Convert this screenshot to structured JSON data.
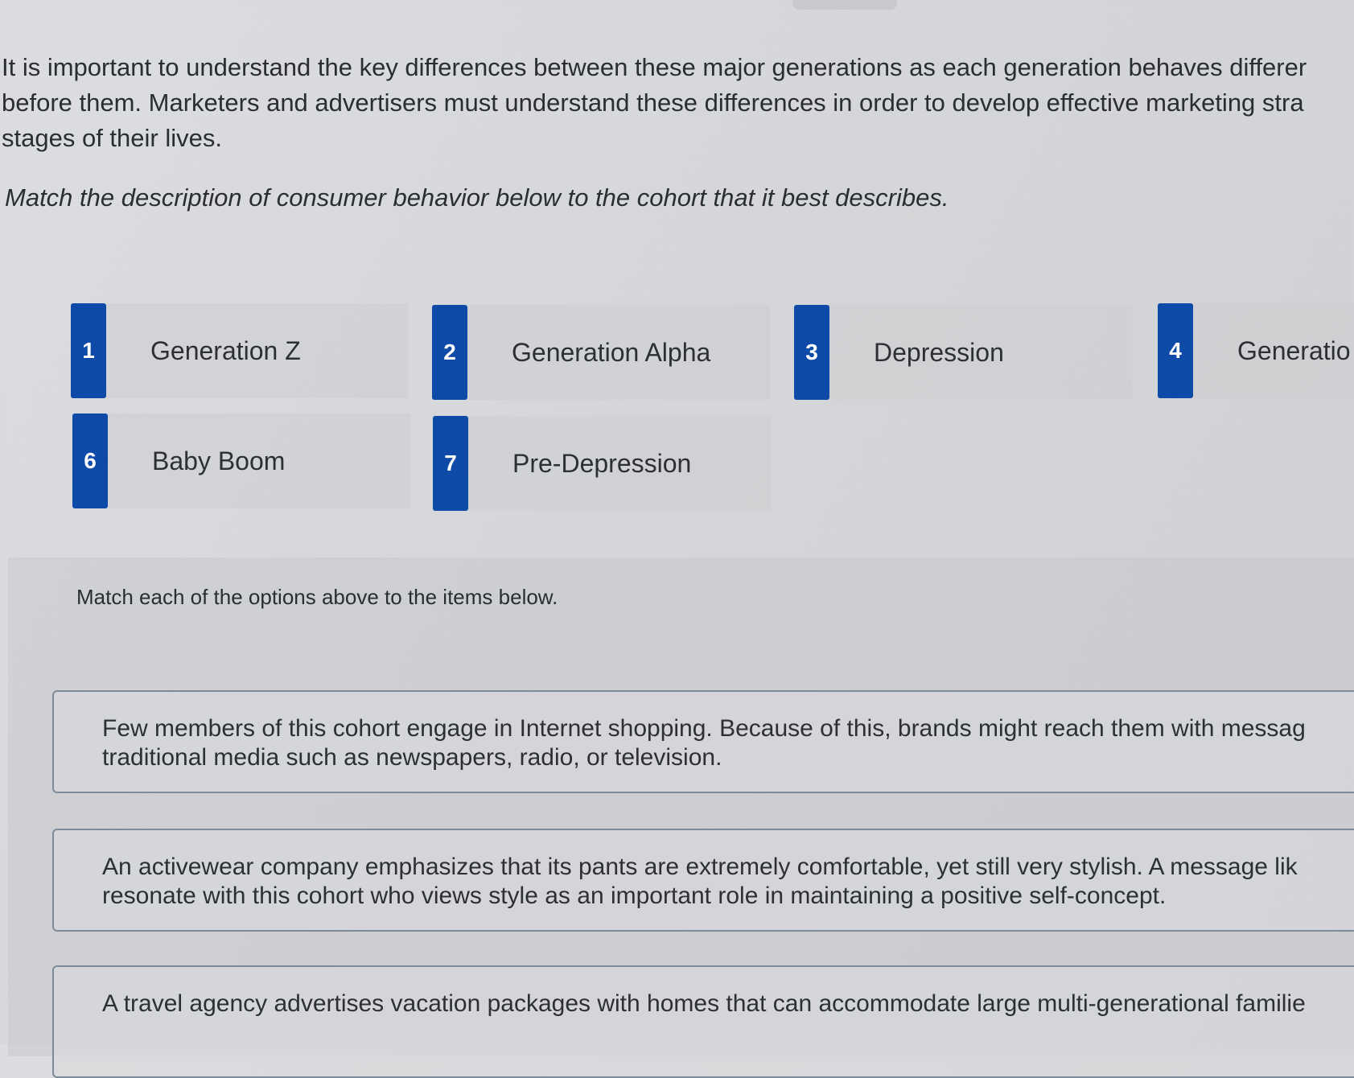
{
  "intro": {
    "line1": "It is important to understand the key differences between these major generations as each generation behaves differer",
    "line2": "before them. Marketers and advertisers must understand these differences in order to develop effective marketing stra",
    "line3": "stages of their lives."
  },
  "instruction": "Match the description of consumer behavior below to the cohort that it best describes.",
  "options": [
    {
      "number": "1",
      "label": "Generation Z"
    },
    {
      "number": "2",
      "label": "Generation Alpha"
    },
    {
      "number": "3",
      "label": "Depression"
    },
    {
      "number": "4",
      "label": "Generatio"
    },
    {
      "number": "6",
      "label": "Baby Boom"
    },
    {
      "number": "7",
      "label": "Pre-Depression"
    }
  ],
  "match": {
    "title": "Match each of the options above to the items below.",
    "items": [
      {
        "line1": "Few members of this cohort engage in Internet shopping. Because of this, brands might reach them with messag",
        "line2": "traditional media such as newspapers, radio, or television."
      },
      {
        "line1": "An activewear company emphasizes that its pants are extremely comfortable, yet still very stylish. A message lik",
        "line2": "resonate with this cohort who views style as an important role in maintaining a positive self-concept."
      },
      {
        "line1": "A travel agency advertises vacation packages with homes that can accommodate large multi-generational familie",
        "line2": ""
      }
    ]
  },
  "colors": {
    "badge": "#0e4aa8",
    "card_border": "#7d8a99"
  }
}
